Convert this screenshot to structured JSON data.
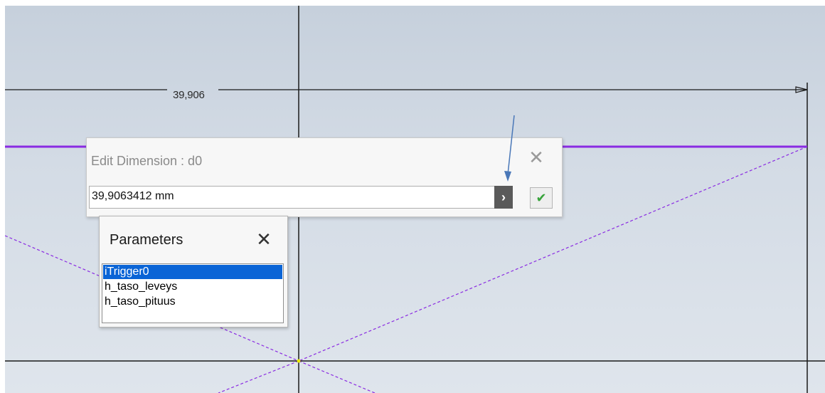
{
  "sketch": {
    "dimension_label": "39,906"
  },
  "edit_dimension": {
    "title": "Edit Dimension : d0",
    "value": "39,9063412 mm",
    "close_glyph": "✕",
    "expand_glyph": "›",
    "accept_glyph": "✔",
    "accept_color": "#38a33b"
  },
  "parameters": {
    "title": "Parameters",
    "close_glyph": "✕",
    "items": [
      {
        "label": "iTrigger0",
        "selected": true
      },
      {
        "label": "h_taso_leveys",
        "selected": false
      },
      {
        "label": "h_taso_pituus",
        "selected": false
      }
    ]
  },
  "colors": {
    "sketch_line": "#8a2be2",
    "selection": "#0a64d6",
    "annotation_arrow": "#4a78b8"
  }
}
